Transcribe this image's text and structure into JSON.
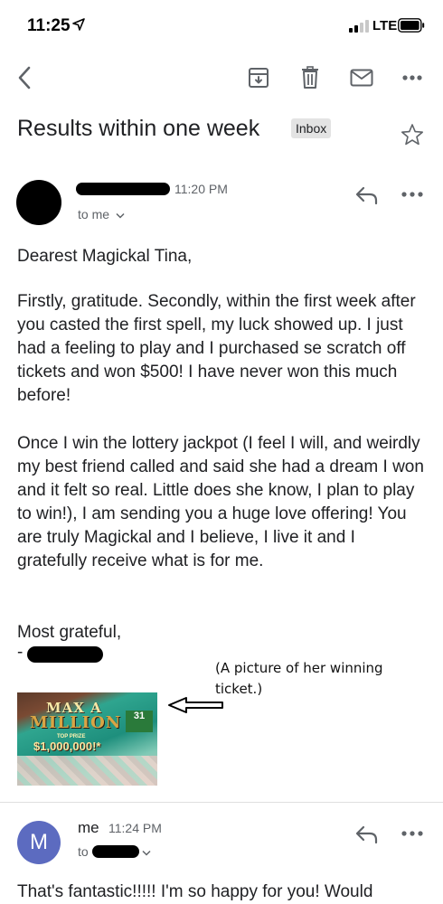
{
  "status_bar": {
    "time": "11:25",
    "network": "LTE"
  },
  "toolbar": {
    "icons": [
      "back-arrow-icon",
      "archive-icon",
      "trash-icon",
      "mail-icon",
      "more-icon"
    ]
  },
  "subject": {
    "title": "Results within one week",
    "label": "Inbox"
  },
  "message1": {
    "time": "11:20 PM",
    "to": "to me",
    "greeting": "Dearest Magickal Tina,",
    "paragraph1": "Firstly, gratitude.  Secondly, within the first week after you casted the first spell, my luck showed up. I just had a feeling to play and I purchased se scratch off tickets and won $500! I have never won this much before!",
    "paragraph2": "Once I win the lottery jackpot (I feel I will, and weirdly my best friend called and said she had a dream I won and it felt so real. Little does she know, I plan to play to win!), I am sending you a huge love offering! You are truly Magickal and I believe, I live it and I gratefully receive what is for me.",
    "closing": "Most grateful,",
    "signature_prefix": "-",
    "annotation": "(A picture of her winning ticket.)",
    "ticket": {
      "line1": "MAX A",
      "line2": "MILLION",
      "badge": "31",
      "prize_label": "TOP PRIZE",
      "prize": "$1,000,000!*"
    }
  },
  "message2": {
    "avatar_letter": "M",
    "sender": "me",
    "time": "11:24 PM",
    "to": "to",
    "preview": "That's fantastic!!!!!  I'm so happy for you!  Would"
  },
  "colors": {
    "avatar_bg": "#5c6bc0",
    "text": "#202124",
    "secondary": "#5f6368",
    "label_bg": "#e3e3e3"
  }
}
